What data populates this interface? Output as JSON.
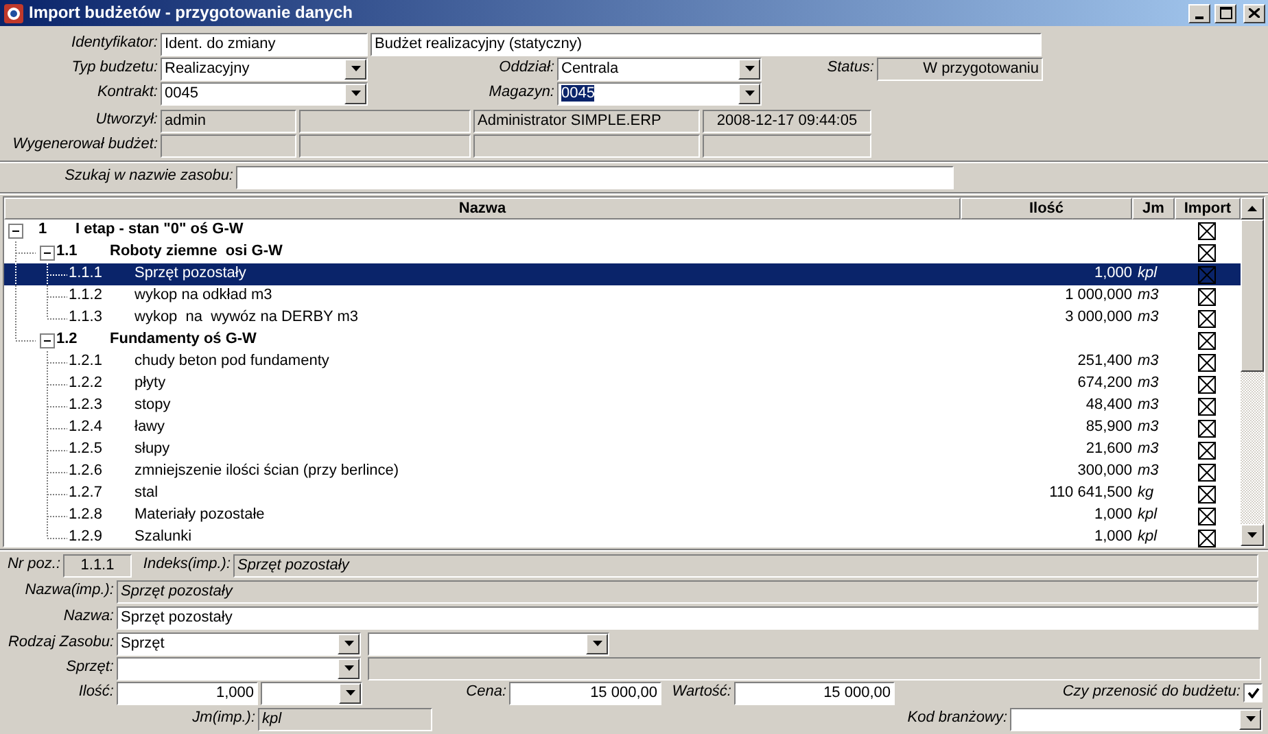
{
  "window": {
    "title": "Import budżetów - przygotowanie danych"
  },
  "header": {
    "identifier": {
      "label": "Identyfikator:",
      "value": "Ident. do zmiany",
      "description": "Budżet realizacyjny (statyczny)"
    },
    "budget_type": {
      "label": "Typ budzetu:",
      "value": "Realizacyjny"
    },
    "branch": {
      "label": "Oddział:",
      "value": "Centrala"
    },
    "status": {
      "label": "Status:",
      "value": "W przygotowaniu"
    },
    "contract": {
      "label": "Kontrakt:",
      "value": "0045"
    },
    "warehouse": {
      "label": "Magazyn:",
      "value": "0045",
      "highlighted": true
    },
    "created_by": {
      "label": "Utworzył:",
      "login": "admin",
      "name": "Administrator SIMPLE.ERP",
      "date": "2008-12-17 09:44:05"
    },
    "generated_by": {
      "label": "Wygenerował budżet:"
    }
  },
  "search": {
    "label": "Szukaj w nazwie zasobu:"
  },
  "table": {
    "columns": [
      "Nazwa",
      "Ilość",
      "Jm",
      "Import"
    ],
    "rows": [
      {
        "number": "1",
        "name": "I etap - stan \"0\" oś G-W",
        "import": true,
        "expanded": true,
        "selected": false,
        "children": [
          {
            "number": "1.1",
            "name": "Roboty ziemne  osi G-W",
            "import": true,
            "expanded": true,
            "selected": false,
            "children": [
              {
                "number": "1.1.1",
                "name": "Sprzęt pozostały",
                "quantity": "1,000",
                "unit": "kpl",
                "import": true,
                "selected": true
              },
              {
                "number": "1.1.2",
                "name": "wykop na odkład m3",
                "quantity": "1 000,000",
                "unit": "m3",
                "import": true,
                "selected": false
              },
              {
                "number": "1.1.3",
                "name": "wykop  na  wywóz na DERBY m3",
                "quantity": "3 000,000",
                "unit": "m3",
                "import": true,
                "selected": false
              }
            ]
          },
          {
            "number": "1.2",
            "name": "Fundamenty oś G-W",
            "import": true,
            "expanded": true,
            "selected": false,
            "children": [
              {
                "number": "1.2.1",
                "name": "chudy beton pod fundamenty",
                "quantity": "251,400",
                "unit": "m3",
                "import": true,
                "selected": false
              },
              {
                "number": "1.2.2",
                "name": "płyty",
                "quantity": "674,200",
                "unit": "m3",
                "import": true,
                "selected": false
              },
              {
                "number": "1.2.3",
                "name": "stopy",
                "quantity": "48,400",
                "unit": "m3",
                "import": true,
                "selected": false
              },
              {
                "number": "1.2.4",
                "name": "ławy",
                "quantity": "85,900",
                "unit": "m3",
                "import": true,
                "selected": false
              },
              {
                "number": "1.2.5",
                "name": "słupy",
                "quantity": "21,600",
                "unit": "m3",
                "import": true,
                "selected": false
              },
              {
                "number": "1.2.6",
                "name": "zmniejszenie ilości ścian (przy berlince)",
                "quantity": "300,000",
                "unit": "m3",
                "import": true,
                "selected": false
              },
              {
                "number": "1.2.7",
                "name": "stal",
                "quantity": "110 641,500",
                "unit": "kg",
                "import": true,
                "selected": false
              },
              {
                "number": "1.2.8",
                "name": "Materiały pozostałe",
                "quantity": "1,000",
                "unit": "kpl",
                "import": true,
                "selected": false
              },
              {
                "number": "1.2.9",
                "name": "Szalunki",
                "quantity": "1,000",
                "unit": "kpl",
                "import": true,
                "selected": false
              }
            ]
          }
        ]
      }
    ]
  },
  "details": {
    "position": {
      "label": "Nr poz.:",
      "value": "1.1.1"
    },
    "import_index": {
      "label": "Indeks(imp.):",
      "value": "Sprzęt pozostały"
    },
    "import_name": {
      "label": "Nazwa(imp.):",
      "value": "Sprzęt pozostały"
    },
    "name": {
      "label": "Nazwa:",
      "value": "Sprzęt pozostały"
    },
    "resource_type": {
      "label": "Rodzaj Zasobu:",
      "value": "Sprzęt"
    },
    "equipment": {
      "label": "Sprzęt:"
    },
    "quantity": {
      "label": "Ilość:",
      "value": "1,000"
    },
    "price": {
      "label": "Cena:",
      "value": "15 000,00"
    },
    "value": {
      "label": "Wartość:",
      "value": "15 000,00"
    },
    "transfer": {
      "label": "Czy przenosić do budżetu:",
      "checked": true
    },
    "import_unit": {
      "label": "Jm(imp.):",
      "value": "kpl"
    },
    "industry_code": {
      "label": "Kod branżowy:"
    }
  }
}
